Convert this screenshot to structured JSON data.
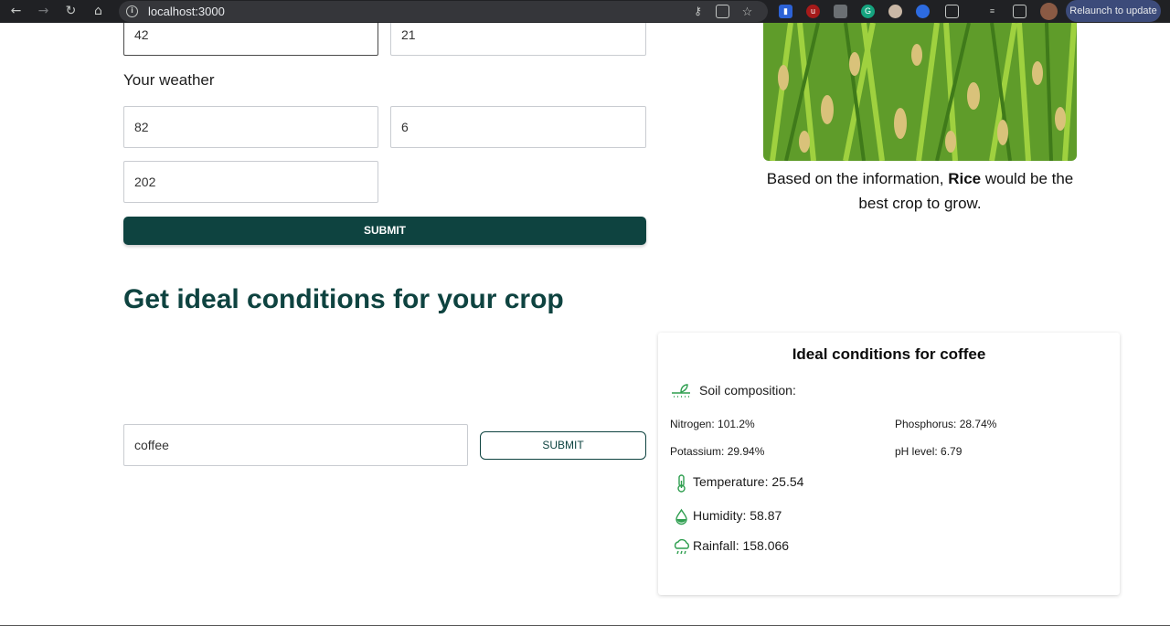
{
  "browser": {
    "url": "localhost:3000",
    "relaunch_label": "Relaunch to update"
  },
  "form": {
    "top_values": [
      "42",
      "21"
    ],
    "weather_label": "Your weather",
    "weather_values": [
      "82",
      "6",
      "202"
    ],
    "submit_label": "SUBMIT"
  },
  "recommendation": {
    "prefix": "Based on the information,",
    "crop": "Rice",
    "suffix": "would be the best crop to grow."
  },
  "ideal": {
    "heading": "Get ideal conditions for your crop",
    "crop_input": "coffee",
    "submit_label": "SUBMIT"
  },
  "card": {
    "title": "Ideal conditions for coffee",
    "soil_label": "Soil composition:",
    "nitrogen": "Nitrogen: 101.2%",
    "phosphorus": "Phosphorus: 28.74%",
    "potassium": "Potassium: 29.94%",
    "ph": "pH level: 6.79",
    "temperature": "Temperature: 25.54",
    "humidity": "Humidity: 58.87",
    "rainfall": "Rainfall: 158.066"
  },
  "colors": {
    "brand_dark_green": "#0e4340",
    "icon_green": "#2e9e4f"
  }
}
